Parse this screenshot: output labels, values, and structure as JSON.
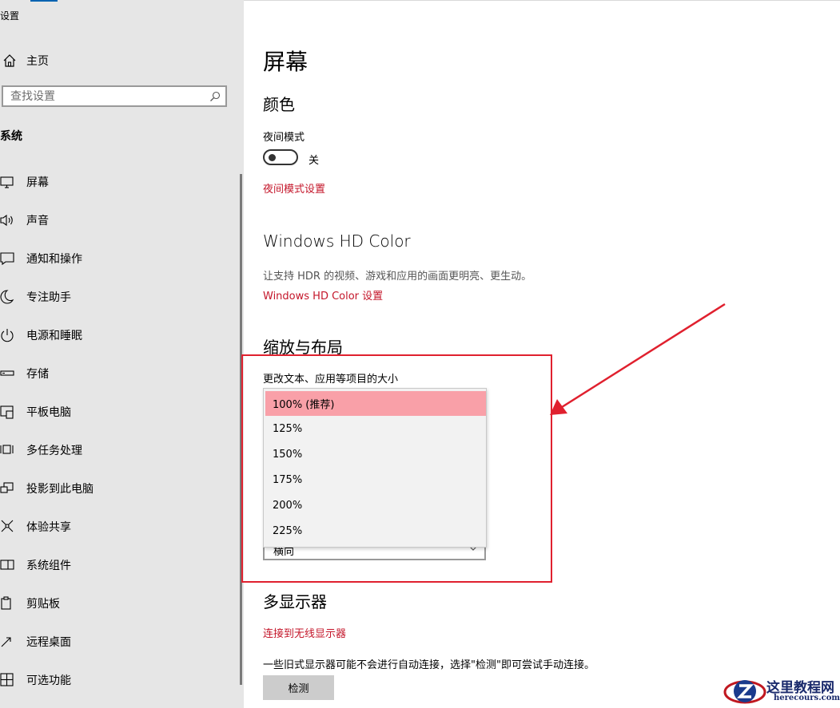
{
  "window": {
    "title": "设置"
  },
  "sidebar": {
    "home_label": "主页",
    "search_placeholder": "查找设置",
    "section_label": "系统",
    "items": [
      {
        "label": "屏幕",
        "icon": "monitor-icon"
      },
      {
        "label": "声音",
        "icon": "speaker-icon"
      },
      {
        "label": "通知和操作",
        "icon": "message-icon"
      },
      {
        "label": "专注助手",
        "icon": "moon-icon"
      },
      {
        "label": "电源和睡眠",
        "icon": "power-icon"
      },
      {
        "label": "存储",
        "icon": "drive-icon"
      },
      {
        "label": "平板电脑",
        "icon": "tablet-icon"
      },
      {
        "label": "多任务处理",
        "icon": "multitask-icon"
      },
      {
        "label": "投影到此电脑",
        "icon": "project-icon"
      },
      {
        "label": "体验共享",
        "icon": "share-icon"
      },
      {
        "label": "系统组件",
        "icon": "components-icon"
      },
      {
        "label": "剪贴板",
        "icon": "clipboard-icon"
      },
      {
        "label": "远程桌面",
        "icon": "remote-icon"
      },
      {
        "label": "可选功能",
        "icon": "features-icon"
      }
    ]
  },
  "main": {
    "page_title": "屏幕",
    "color": {
      "heading": "颜色",
      "night_mode_label": "夜间模式",
      "night_mode_state": "关",
      "night_mode_link": "夜间模式设置"
    },
    "hdr": {
      "heading": "Windows HD Color",
      "description": "让支持 HDR 的视频、游戏和应用的画面更明亮、更生动。",
      "link": "Windows HD Color 设置"
    },
    "scale": {
      "heading": "缩放与布局",
      "label": "更改文本、应用等项目的大小",
      "options": [
        "100% (推荐)",
        "125%",
        "150%",
        "175%",
        "200%",
        "225%"
      ],
      "selected_index": 0,
      "orientation_value": "横向"
    },
    "multi": {
      "heading": "多显示器",
      "link": "连接到无线显示器",
      "description": "一些旧式显示器可能不会进行自动连接，选择\"检测\"即可尝试手动连接。",
      "detect_button": "检测"
    }
  },
  "annotation": {
    "box_color": "#e0202e",
    "arrow_color": "#e0202e"
  },
  "watermark": {
    "title": "这里教程网",
    "url": "herecours.com"
  },
  "colors": {
    "accent_link": "#c4162a",
    "selection": "#f9a0a8",
    "sidebar_bg": "#e6e6e6"
  }
}
